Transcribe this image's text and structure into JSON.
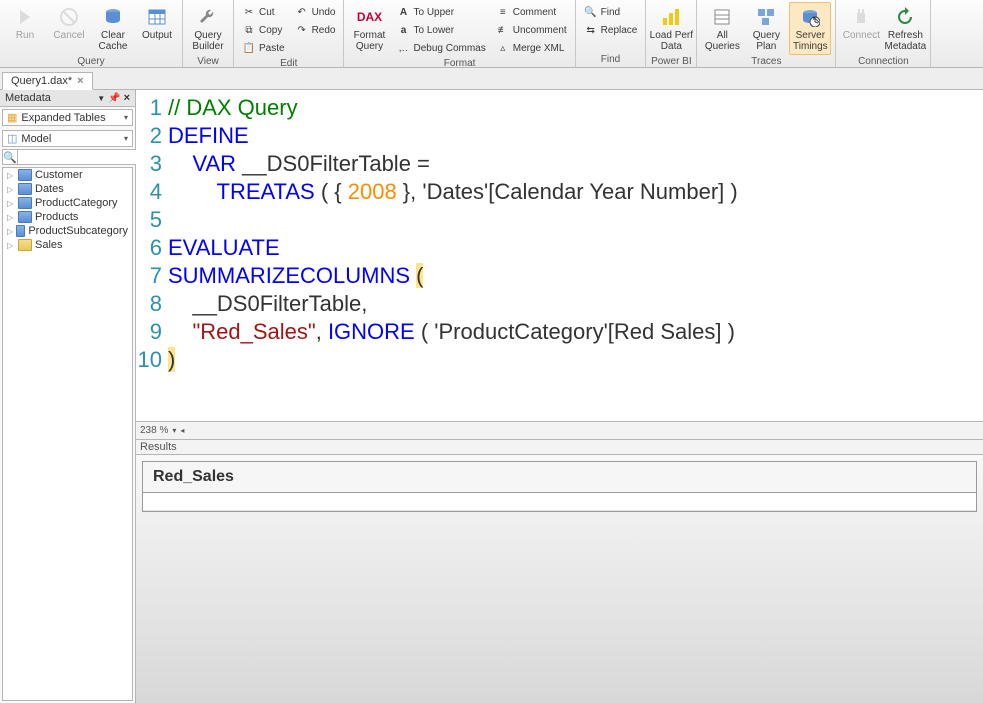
{
  "ribbon": {
    "groups": {
      "query": {
        "label": "Query",
        "run": "Run",
        "cancel": "Cancel",
        "clear": "Clear\nCache",
        "output": "Output"
      },
      "view": {
        "label": "View",
        "builder": "Query\nBuilder"
      },
      "edit": {
        "label": "Edit",
        "cut": "Cut",
        "copy": "Copy",
        "paste": "Paste",
        "undo": "Undo",
        "redo": "Redo"
      },
      "format": {
        "label": "Format",
        "dax": "Format\nQuery",
        "upper": "To Upper",
        "lower": "To Lower",
        "debug": "Debug Commas",
        "comment": "Comment",
        "uncomment": "Uncomment",
        "merge": "Merge XML"
      },
      "find": {
        "label": "Find",
        "find": "Find",
        "replace": "Replace"
      },
      "powerbi": {
        "label": "Power BI",
        "load": "Load Perf\nData"
      },
      "traces": {
        "label": "Traces",
        "all": "All\nQueries",
        "plan": "Query\nPlan",
        "timings": "Server\nTimings"
      },
      "connection": {
        "label": "Connection",
        "connect": "Connect",
        "refresh": "Refresh\nMetadata"
      }
    }
  },
  "tab": {
    "name": "Query1.dax*"
  },
  "metadata": {
    "title": "Metadata",
    "combo1": "Expanded Tables",
    "combo2": "Model",
    "tables": [
      "Customer",
      "Dates",
      "ProductCategory",
      "Products",
      "ProductSubcategory",
      "Sales"
    ]
  },
  "code": {
    "lines": [
      {
        "n": "1",
        "seg": [
          {
            "t": "// DAX Query",
            "c": "cm"
          }
        ]
      },
      {
        "n": "2",
        "seg": [
          {
            "t": "DEFINE",
            "c": "kw"
          }
        ]
      },
      {
        "n": "3",
        "seg": [
          {
            "t": "    ",
            "c": ""
          },
          {
            "t": "VAR",
            "c": "kw"
          },
          {
            "t": " __DS0FilterTable =",
            "c": ""
          }
        ]
      },
      {
        "n": "4",
        "seg": [
          {
            "t": "        ",
            "c": ""
          },
          {
            "t": "TREATAS",
            "c": "fn"
          },
          {
            "t": " ( { ",
            "c": ""
          },
          {
            "t": "2008",
            "c": "num"
          },
          {
            "t": " }, 'Dates'[Calendar Year Number] )",
            "c": ""
          }
        ]
      },
      {
        "n": "5",
        "seg": [
          {
            "t": "",
            "c": ""
          }
        ]
      },
      {
        "n": "6",
        "seg": [
          {
            "t": "EVALUATE",
            "c": "kw"
          }
        ]
      },
      {
        "n": "7",
        "seg": [
          {
            "t": "SUMMARIZECOLUMNS",
            "c": "fn"
          },
          {
            "t": " ",
            "c": ""
          },
          {
            "t": "(",
            "c": "hl"
          }
        ]
      },
      {
        "n": "8",
        "seg": [
          {
            "t": "    __DS0FilterTable,",
            "c": ""
          }
        ]
      },
      {
        "n": "9",
        "seg": [
          {
            "t": "    ",
            "c": ""
          },
          {
            "t": "\"Red_Sales\"",
            "c": "str"
          },
          {
            "t": ", ",
            "c": ""
          },
          {
            "t": "IGNORE",
            "c": "fn"
          },
          {
            "t": " ( 'ProductCategory'[Red Sales] )",
            "c": ""
          }
        ]
      },
      {
        "n": "10",
        "seg": [
          {
            "t": ")",
            "c": "hl"
          }
        ]
      }
    ]
  },
  "status": {
    "zoom": "238 %"
  },
  "results": {
    "title": "Results",
    "col": "Red_Sales"
  }
}
